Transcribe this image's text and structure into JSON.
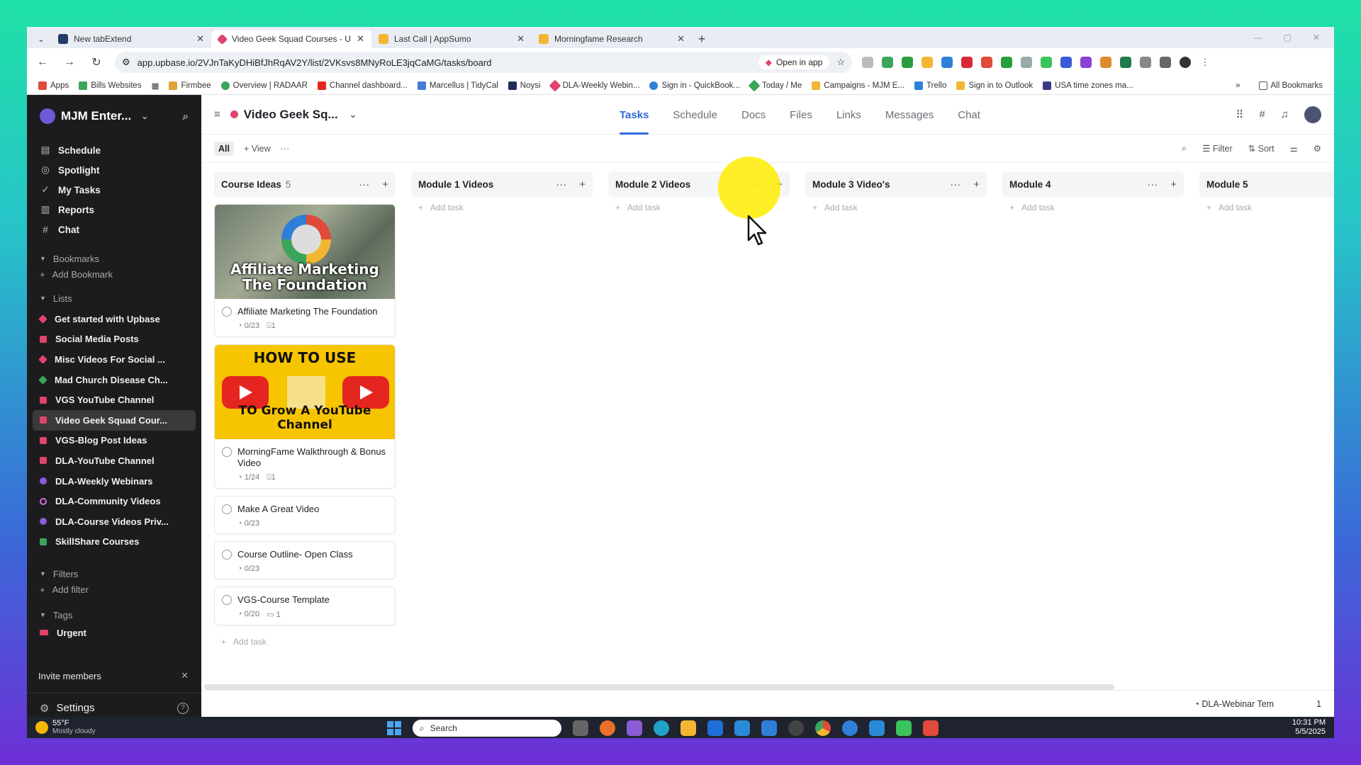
{
  "browser": {
    "tabs": [
      {
        "title": "New tabExtend",
        "color": "#243a6b",
        "active": false
      },
      {
        "title": "Video Geek Squad Courses - U",
        "color": "#e0446a",
        "active": true
      },
      {
        "title": "Last Call | AppSumo",
        "color": "#f2b632",
        "active": false
      },
      {
        "title": "Morningfame Research",
        "color": "#f2b632",
        "active": false
      }
    ],
    "url": "app.upbase.io/2VJnTaKyDHiBfJhRqAV2Y/list/2VKsvs8MNyRoLE3jqCaMG/tasks/board",
    "open_in_app": "Open in app",
    "bookmarks": [
      "Apps",
      "Bills Websites",
      "Firmbee",
      "Overview | RADAAR",
      "Channel dashboard...",
      "Marcellus | TidyCal",
      "Noysi",
      "DLA-Weekly Webin...",
      "Sign in - QuickBook...",
      "Today / Me",
      "Campaigns - MJM E...",
      "Trello",
      "Sign in to Outlook",
      "USA time zones ma..."
    ],
    "all_bookmarks": "All Bookmarks"
  },
  "sidebar": {
    "workspace": "MJM Enter...",
    "nav": [
      {
        "label": "Schedule",
        "icon": "calendar-icon"
      },
      {
        "label": "Spotlight",
        "icon": "spotlight-icon"
      },
      {
        "label": "My Tasks",
        "icon": "check-circle-icon"
      },
      {
        "label": "Reports",
        "icon": "bar-chart-icon"
      },
      {
        "label": "Chat",
        "icon": "hash-icon"
      }
    ],
    "bookmarks_header": "Bookmarks",
    "add_bookmark": "Add Bookmark",
    "lists_header": "Lists",
    "lists": [
      {
        "label": "Get started with Upbase",
        "color": "#e0446a",
        "shape": "diamond"
      },
      {
        "label": "Social Media Posts",
        "color": "#e0446a",
        "shape": "square"
      },
      {
        "label": "Misc Videos For Social ...",
        "color": "#e0446a",
        "shape": "diamond"
      },
      {
        "label": "Mad Church Disease Ch...",
        "color": "#3ba55c",
        "shape": "diamond"
      },
      {
        "label": "VGS YouTube Channel",
        "color": "#e0446a",
        "shape": "square"
      },
      {
        "label": "Video Geek Squad Cour...",
        "color": "#e0446a",
        "shape": "square",
        "selected": true
      },
      {
        "label": "VGS-Blog Post Ideas",
        "color": "#e0446a",
        "shape": "square"
      },
      {
        "label": "DLA-YouTube Channel",
        "color": "#e0446a",
        "shape": "square"
      },
      {
        "label": "DLA-Weekly Webinars",
        "color": "#8a5cd6",
        "shape": "square"
      },
      {
        "label": "DLA-Community Videos",
        "color": "#d86be0",
        "shape": "ring"
      },
      {
        "label": "DLA-Course Videos Priv...",
        "color": "#8a5cd6",
        "shape": "square"
      },
      {
        "label": "SkillShare Courses",
        "color": "#3ba55c",
        "shape": "square"
      }
    ],
    "filters_header": "Filters",
    "add_filter": "Add filter",
    "tags_header": "Tags",
    "tags": [
      {
        "label": "Urgent",
        "color": "#e0446a"
      }
    ],
    "invite": "Invite members",
    "settings": "Settings"
  },
  "project": {
    "title": "Video Geek Sq...",
    "tabs": [
      "Tasks",
      "Schedule",
      "Docs",
      "Files",
      "Links",
      "Messages",
      "Chat"
    ],
    "active_tab": "Tasks"
  },
  "viewbar": {
    "all": "All",
    "view": "+ View",
    "filter": "Filter",
    "sort": "Sort"
  },
  "board": {
    "add_task": "Add task",
    "columns": [
      {
        "title": "Course Ideas",
        "count": "5"
      },
      {
        "title": "Module 1 Videos",
        "count": ""
      },
      {
        "title": "Module 2 Videos",
        "count": ""
      },
      {
        "title": "Module 3 Video's",
        "count": ""
      },
      {
        "title": "Module 4",
        "count": ""
      },
      {
        "title": "Module 5",
        "count": ""
      }
    ],
    "cards": [
      {
        "name": "Affiliate Marketing The Foundation",
        "subtasks": "0/23",
        "attach": "1",
        "cover": "affiliate",
        "cover_text": "Affiliate Marketing The Foundation"
      },
      {
        "name": "MorningFame Walkthrough & Bonus Video",
        "subtasks": "1/24",
        "attach": "1",
        "cover": "youtube",
        "cover_top": "HOW TO USE",
        "cover_bottom": "TO Grow A YouTube Channel"
      },
      {
        "name": "Make A Great Video",
        "subtasks": "0/23"
      },
      {
        "name": "Course Outline- Open Class",
        "subtasks": "0/23"
      },
      {
        "name": "VGS-Course Template",
        "subtasks": "0/20",
        "comments": "1"
      }
    ]
  },
  "footer": {
    "item": "DLA-Webinar Tem",
    "count": "1"
  },
  "taskbar": {
    "temp": "55°F",
    "weather": "Mostly cloudy",
    "search": "Search",
    "time": "10:31 PM",
    "date": "5/5/2025"
  },
  "colors": {
    "accent": "#2f6bd8",
    "brand": "#e0446a",
    "sidebar_bg": "#1c1c1e"
  }
}
